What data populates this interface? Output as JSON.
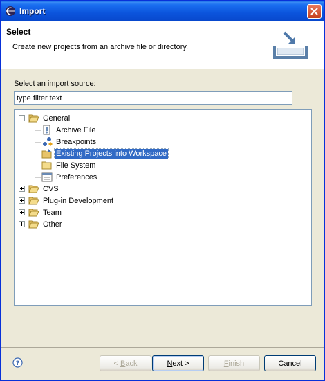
{
  "window": {
    "title": "Import"
  },
  "header": {
    "title": "Select",
    "description": "Create new projects from an archive file or directory."
  },
  "source_label": {
    "prefix": "",
    "mnemonic": "S",
    "rest": "elect an import source:"
  },
  "filter": {
    "value": "type filter text"
  },
  "tree": {
    "general": {
      "label": "General",
      "children": {
        "archive": "Archive File",
        "breakpoints": "Breakpoints",
        "existing": "Existing Projects into Workspace",
        "filesystem": "File System",
        "preferences": "Preferences"
      }
    },
    "cvs": "CVS",
    "plugin": "Plug-in Development",
    "team": "Team",
    "other": "Other"
  },
  "buttons": {
    "back": {
      "mn": "B",
      "pre": "< ",
      "rest": "ack"
    },
    "next": {
      "mn": "N",
      "pre": "",
      "rest": "ext >"
    },
    "finish": {
      "mn": "F",
      "pre": "",
      "rest": "inish"
    },
    "cancel": "Cancel"
  }
}
